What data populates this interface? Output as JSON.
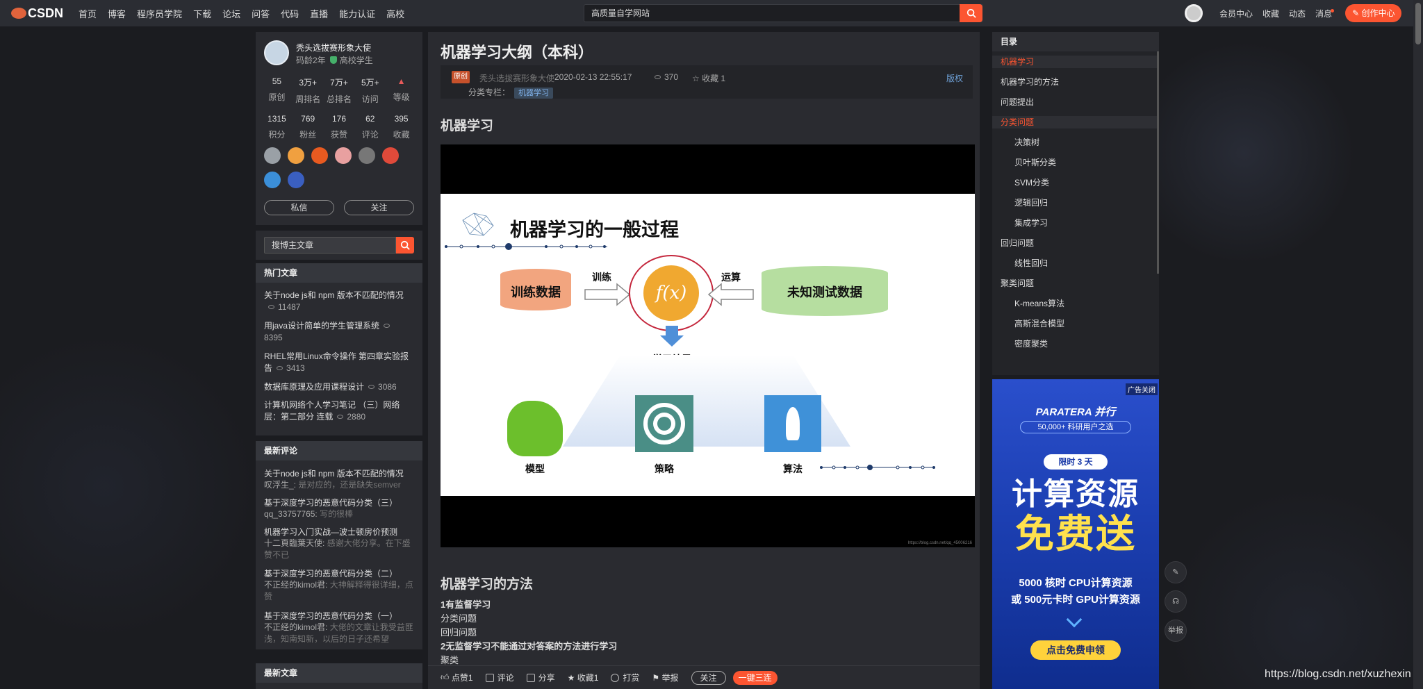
{
  "nav": {
    "logo": "CSDN",
    "items": [
      "首页",
      "博客",
      "程序员学院",
      "下载",
      "论坛",
      "问答",
      "代码",
      "直播",
      "能力认证",
      "高校"
    ],
    "search_placeholder": "高质量自学网站",
    "right": [
      "会员中心",
      "收藏",
      "动态",
      "消息"
    ],
    "create": "创作中心"
  },
  "profile": {
    "name": "秃头选拔赛形象大使",
    "sub_age": "码龄2年",
    "sub_tag": "高校学生",
    "stats1": [
      {
        "v": "55",
        "l": "原创"
      },
      {
        "v": "3万+",
        "l": "周排名"
      },
      {
        "v": "7万+",
        "l": "总排名"
      },
      {
        "v": "5万+",
        "l": "访问"
      },
      {
        "v": "",
        "l": "等级"
      }
    ],
    "stats2": [
      {
        "v": "1315",
        "l": "积分"
      },
      {
        "v": "769",
        "l": "粉丝"
      },
      {
        "v": "176",
        "l": "获赞"
      },
      {
        "v": "62",
        "l": "评论"
      },
      {
        "v": "395",
        "l": "收藏"
      }
    ],
    "badge_colors": [
      "#9aa0a6",
      "#f0a040",
      "#e85a20",
      "#e8a0a0",
      "#777777",
      "#e04a3a",
      "#3b8fd9",
      "#3a5fc0"
    ],
    "btn_msg": "私信",
    "btn_follow": "关注"
  },
  "sidebar_search": "搜博主文章",
  "hot": {
    "title": "热门文章",
    "items": [
      {
        "t": "关于node js和 npm 版本不匹配的情况",
        "c": "11487"
      },
      {
        "t": "用java设计简单的学生管理系统",
        "c": "8395"
      },
      {
        "t": "RHEL常用Linux命令操作 第四章实验报告",
        "c": "3413"
      },
      {
        "t": "数据库原理及应用课程设计",
        "c": "3086"
      },
      {
        "t": "计算机网络个人学习笔记 （三）网络层：第二部分 连载",
        "c": "2880"
      }
    ]
  },
  "comments": {
    "title": "最新评论",
    "items": [
      {
        "t": "关于node js和 npm 版本不匹配的情况",
        "u": "叹浮生_:",
        "b": "是对应的，还是缺失semver"
      },
      {
        "t": "基于深度学习的恶意代码分类（三）",
        "u": "qq_33757765:",
        "b": "写的很棒"
      },
      {
        "t": "机器学习入门实战—波士顿房价预测",
        "u": "十二頁臨葉天使:",
        "b": "感谢大佬分享。在下盛赞不已"
      },
      {
        "t": "基于深度学习的恶意代码分类（二）",
        "u": "不正经的kimol君:",
        "b": "大神解释得很详细，点赞"
      },
      {
        "t": "基于深度学习的恶意代码分类（一）",
        "u": "不正经的kimol君:",
        "b": "大佬的文章让我受益匪浅，知南知新，以后的日子还希望"
      }
    ]
  },
  "latest_title": "最新文章",
  "article": {
    "title": "机器学习大纲（本科）",
    "orig": "原创",
    "author": "秃头选拔赛形象大使",
    "date": "2020-02-13 22:55:17",
    "views": "370",
    "fav": "收藏 1",
    "copyright": "版权",
    "column_label": "分类专栏：",
    "column_tag": "机器学习",
    "h_ml": "机器学习",
    "slide": {
      "title": "机器学习的一般过程",
      "train_data": "训练数据",
      "train": "训练",
      "fx": "f(x)",
      "compute": "运算",
      "test_data": "未知测试数据",
      "result": "学习结果",
      "model": "模型",
      "strategy": "策略",
      "algorithm": "算法",
      "credit": "https://blog.csdn.net/qq_45006216"
    },
    "h_methods": "机器学习的方法",
    "lines": [
      "1有监督学习",
      "分类问题",
      "回归问题",
      "2无监督学习不能通过对答案的方法进行学习",
      "聚类"
    ]
  },
  "toolbar": {
    "like": "点赞1",
    "comment": "评论",
    "share": "分享",
    "fav": "收藏1",
    "reward": "打赏",
    "report": "举报",
    "follow": "关注",
    "triple": "一键三连"
  },
  "toc": {
    "title": "目录",
    "items": [
      {
        "t": "机器学习",
        "lvl": 1,
        "active": true
      },
      {
        "t": "机器学习的方法",
        "lvl": 1,
        "active": false
      },
      {
        "t": "问题提出",
        "lvl": 1,
        "active": false
      },
      {
        "t": "分类问题",
        "lvl": 1,
        "active": true
      },
      {
        "t": "决策树",
        "lvl": 2,
        "active": false
      },
      {
        "t": "贝叶斯分类",
        "lvl": 2,
        "active": false
      },
      {
        "t": "SVM分类",
        "lvl": 2,
        "active": false
      },
      {
        "t": "逻辑回归",
        "lvl": 2,
        "active": false
      },
      {
        "t": "集成学习",
        "lvl": 2,
        "active": false
      },
      {
        "t": "回归问题",
        "lvl": 1,
        "active": false
      },
      {
        "t": "线性回归",
        "lvl": 2,
        "active": false
      },
      {
        "t": "聚类问题",
        "lvl": 1,
        "active": false
      },
      {
        "t": "K-means算法",
        "lvl": 2,
        "active": false
      },
      {
        "t": "高斯混合模型",
        "lvl": 2,
        "active": false
      },
      {
        "t": "密度聚类",
        "lvl": 2,
        "active": false
      }
    ]
  },
  "ad": {
    "close": "广告关闭",
    "brand": "PARATERA 并行",
    "users": "50,000+ 科研用户之选",
    "limit": "限时 3 天",
    "big1": "计算资源",
    "big2": "免费送",
    "line1": "5000 核时 CPU计算资源",
    "line2": "或 500元卡时 GPU计算资源",
    "cta": "点击免费申领"
  },
  "float": {
    "report": "举报"
  },
  "watermark": "https://blog.csdn.net/xuzhexin"
}
